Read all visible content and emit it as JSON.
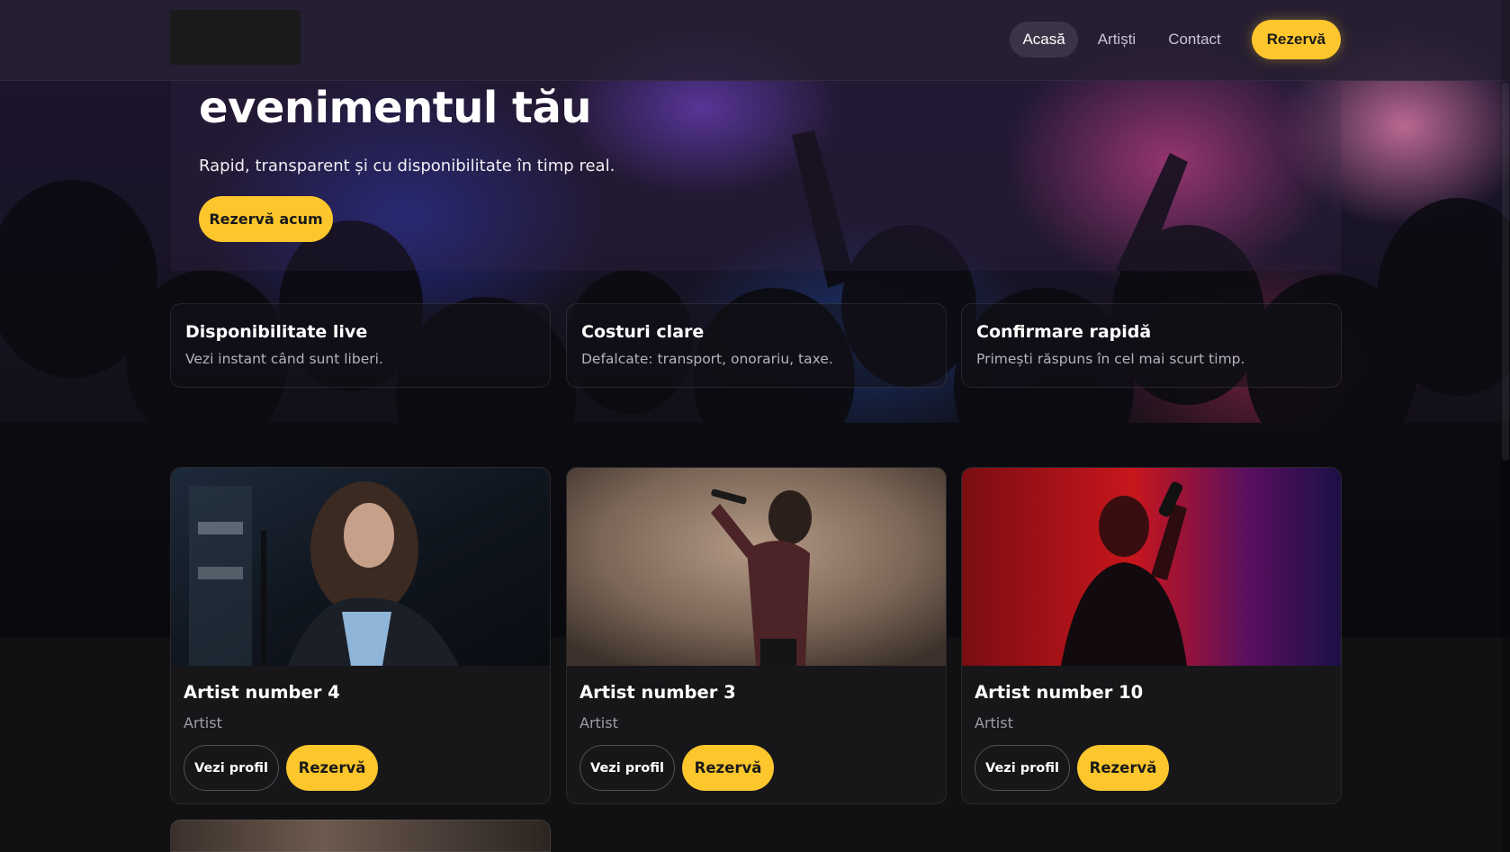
{
  "header": {
    "nav": [
      {
        "label": "Acasă",
        "active": true
      },
      {
        "label": "Artiști",
        "active": false
      },
      {
        "label": "Contact",
        "active": false
      }
    ],
    "cta_label": "Rezervă"
  },
  "hero": {
    "title": "evenimentul tău",
    "subtitle": "Rapid, transparent și cu disponibilitate în timp real.",
    "button_label": "Rezervă acum"
  },
  "features": [
    {
      "title": "Disponibilitate live",
      "text": "Vezi instant când sunt liberi."
    },
    {
      "title": "Costuri clare",
      "text": "Defalcate: transport, onorariu, taxe."
    },
    {
      "title": "Confirmare rapidă",
      "text": "Primești răspuns în cel mai scurt timp."
    }
  ],
  "artists": [
    {
      "name": "Artist number 4",
      "role": "Artist",
      "profile_label": "Vezi profil",
      "book_label": "Rezervă"
    },
    {
      "name": "Artist number 3",
      "role": "Artist",
      "profile_label": "Vezi profil",
      "book_label": "Rezervă"
    },
    {
      "name": "Artist number 10",
      "role": "Artist",
      "profile_label": "Vezi profil",
      "book_label": "Rezervă"
    }
  ],
  "colors": {
    "accent": "#fcc62c",
    "background": "#0f0f12",
    "card": "#17171a"
  }
}
